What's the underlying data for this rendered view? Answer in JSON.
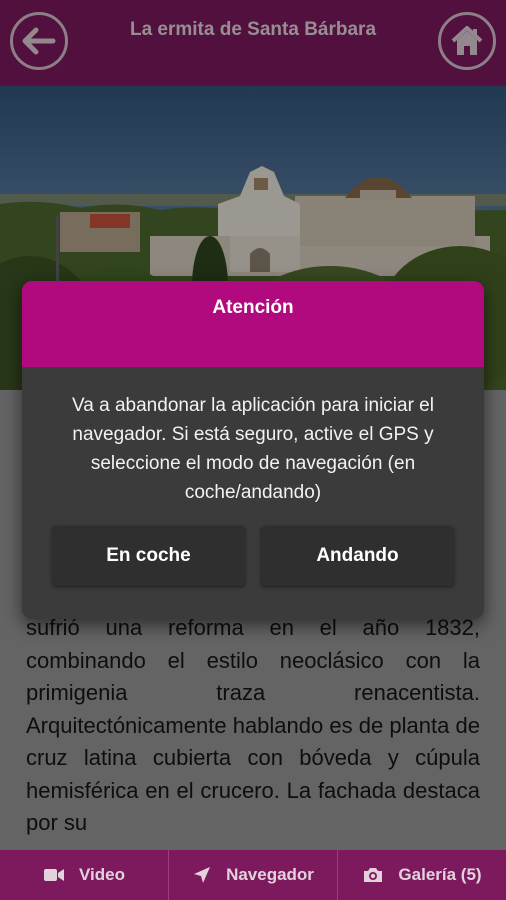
{
  "header": {
    "title": "La ermita de Santa Bárbara",
    "back_icon": "arrow-left-icon",
    "home_icon": "home-icon"
  },
  "hero": {
    "description": "photo-of-hermitage"
  },
  "article": {
    "text": "sufrió una reforma en el año 1832, combinando el estilo neoclásico con la primigenia traza renacentista. Arquitectónicamente hablando es de planta de cruz latina cubierta con bóveda y cúpula hemisférica en el crucero. La fachada destaca por su"
  },
  "dialog": {
    "title": "Atención",
    "message": "Va a abandonar la aplicación para iniciar el navegador. Si está seguro, active el GPS y seleccione el modo de navegación (en coche/andando)",
    "button_car": "En coche",
    "button_walk": "Andando"
  },
  "bottom_nav": {
    "video": "Video",
    "navigator": "Navegador",
    "gallery": "Galería (5)"
  },
  "colors": {
    "header_bg": "#7d1a5e",
    "dialog_header": "#b00a7e",
    "dialog_bg": "#3b3b3b"
  }
}
